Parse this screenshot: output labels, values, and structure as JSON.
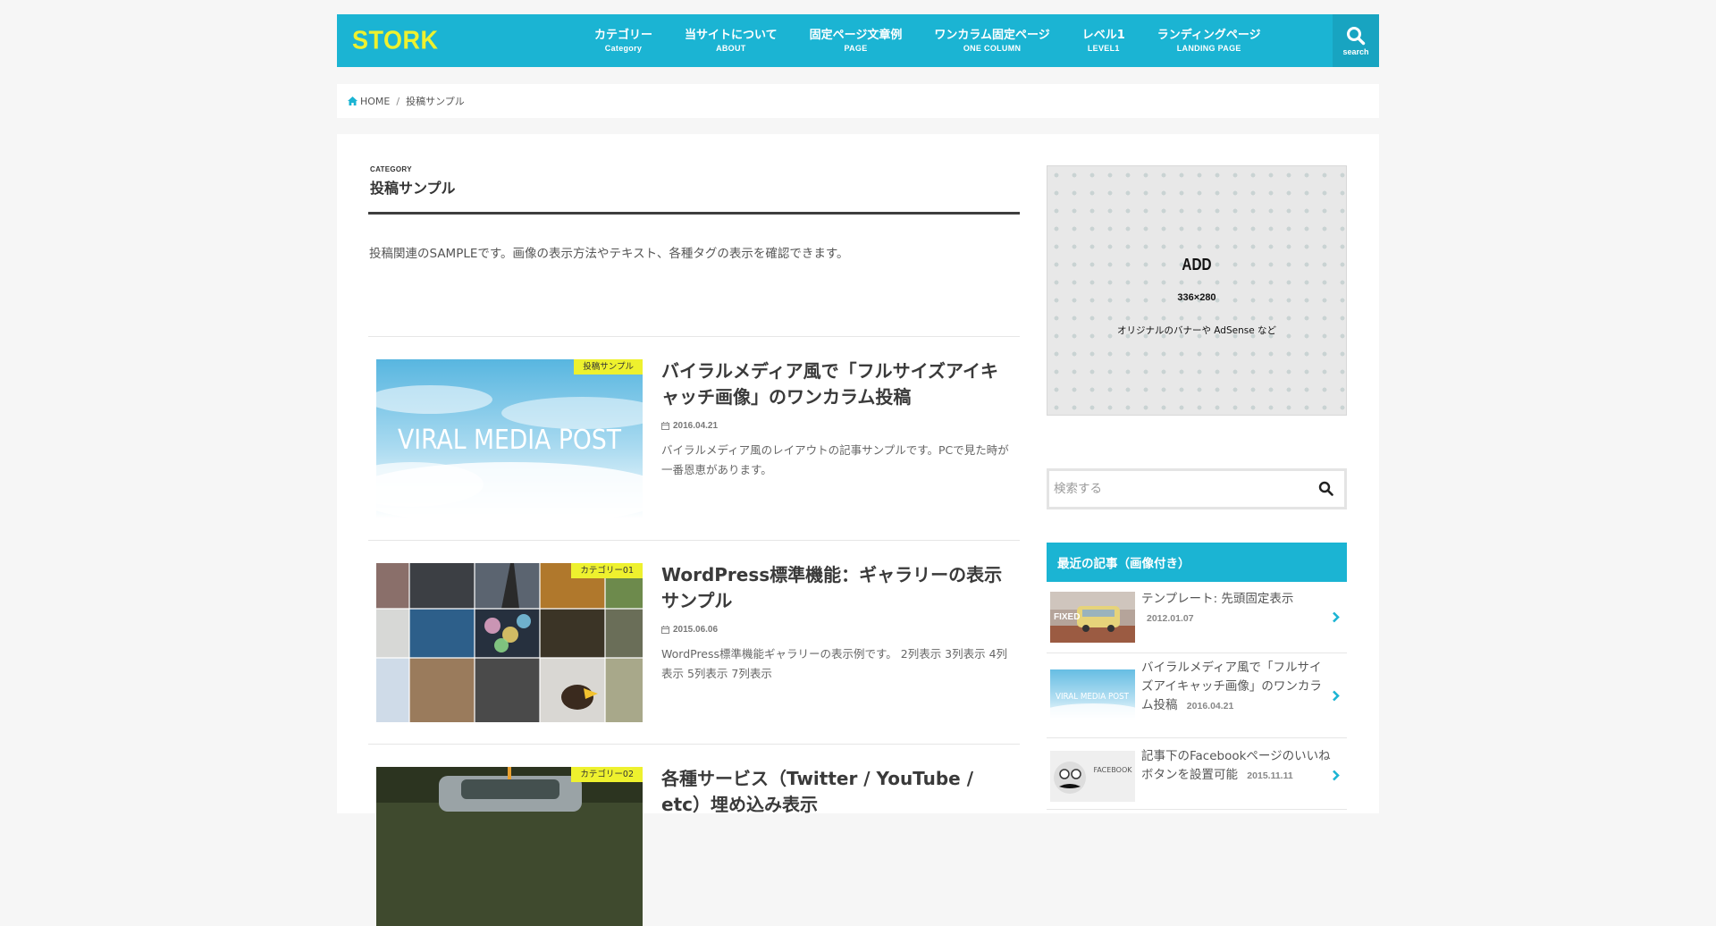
{
  "header": {
    "logo": "STORK",
    "nav": [
      {
        "jp": "カテゴリー",
        "en": "Category"
      },
      {
        "jp": "当サイトについて",
        "en": "ABOUT"
      },
      {
        "jp": "固定ページ文章例",
        "en": "PAGE"
      },
      {
        "jp": "ワンカラム固定ページ",
        "en": "ONE COLUMN"
      },
      {
        "jp": "レベル1",
        "en": "LEVEL1"
      },
      {
        "jp": "ランディングページ",
        "en": "LANDING PAGE"
      }
    ],
    "search_label": "search"
  },
  "breadcrumb": {
    "home": "HOME",
    "current": "投稿サンプル"
  },
  "category": {
    "small": "CATEGORY",
    "title": "投稿サンプル",
    "description": "投稿関連のSAMPLEです。画像の表示方法やテキスト、各種タグの表示を確認できます。"
  },
  "posts": [
    {
      "label": "投稿サンプル",
      "thumb_text": "VIRAL MEDIA POST",
      "title": "バイラルメディア風で「フルサイズアイキャッチ画像」のワンカラム投稿",
      "date": "2016.04.21",
      "excerpt": "バイラルメディア風のレイアウトの記事サンプルです。PCで見た時が一番恩恵があります。"
    },
    {
      "label": "カテゴリー01",
      "title": "WordPress標準機能：ギャラリーの表示サンプル",
      "date": "2015.06.06",
      "excerpt": "WordPress標準機能ギャラリーの表示例です。 2列表示 3列表示 4列表示 5列表示 7列表示"
    },
    {
      "label": "カテゴリー02",
      "title": "各種サービス（Twitter / YouTube / etc）埋め込み表示"
    }
  ],
  "sidebar": {
    "ad": {
      "title": "ADD",
      "size": "336×280",
      "note": "オリジナルのバナーや AdSense など"
    },
    "search_placeholder": "検索する",
    "recent_title": "最近の記事（画像付き）",
    "recent": [
      {
        "title": "テンプレート: 先頭固定表示",
        "date": "2012.01.07",
        "thumb_text": "FIXED"
      },
      {
        "title": "バイラルメディア風で「フルサイズアイキャッチ画像」のワンカラム投稿",
        "date": "2016.04.21",
        "thumb_text": "VIRAL MEDIA POST"
      },
      {
        "title": "記事下のFacebookページのいいねボタンを設置可能",
        "date": "2015.11.11",
        "thumb_text": "FACEBOOK"
      }
    ]
  },
  "colors": {
    "accent": "#1bb4d3",
    "logo": "#eef12e",
    "label": "#eef12e"
  }
}
